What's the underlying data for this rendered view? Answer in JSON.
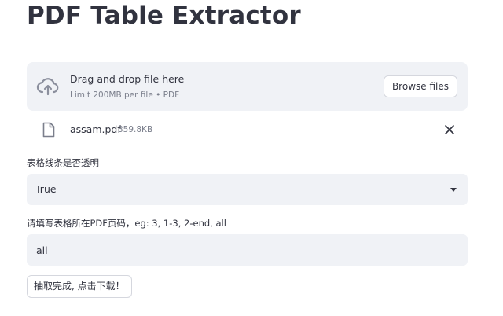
{
  "page": {
    "title": "PDF Table Extractor"
  },
  "uploader": {
    "instruction": "Drag and drop file here",
    "limit": "Limit 200MB per file • PDF",
    "browse_label": "Browse files",
    "icon": "cloud-upload-icon"
  },
  "uploaded_file": {
    "name": "assam.pdf",
    "size": "359.8KB",
    "icon": "file-icon",
    "remove_icon": "close-icon"
  },
  "transparent_lines": {
    "label": "表格线条是否透明",
    "selected": "True"
  },
  "pages_input": {
    "label": "请填写表格所在PDF页码，eg: 3, 1-3, 2-end, all",
    "value": "all"
  },
  "actions": {
    "download_label": "抽取完成, 点击下载！"
  },
  "colors": {
    "text": "#31333f",
    "muted": "#7b7f8c",
    "field_bg": "#f0f2f6",
    "border": "#d5d7de"
  }
}
